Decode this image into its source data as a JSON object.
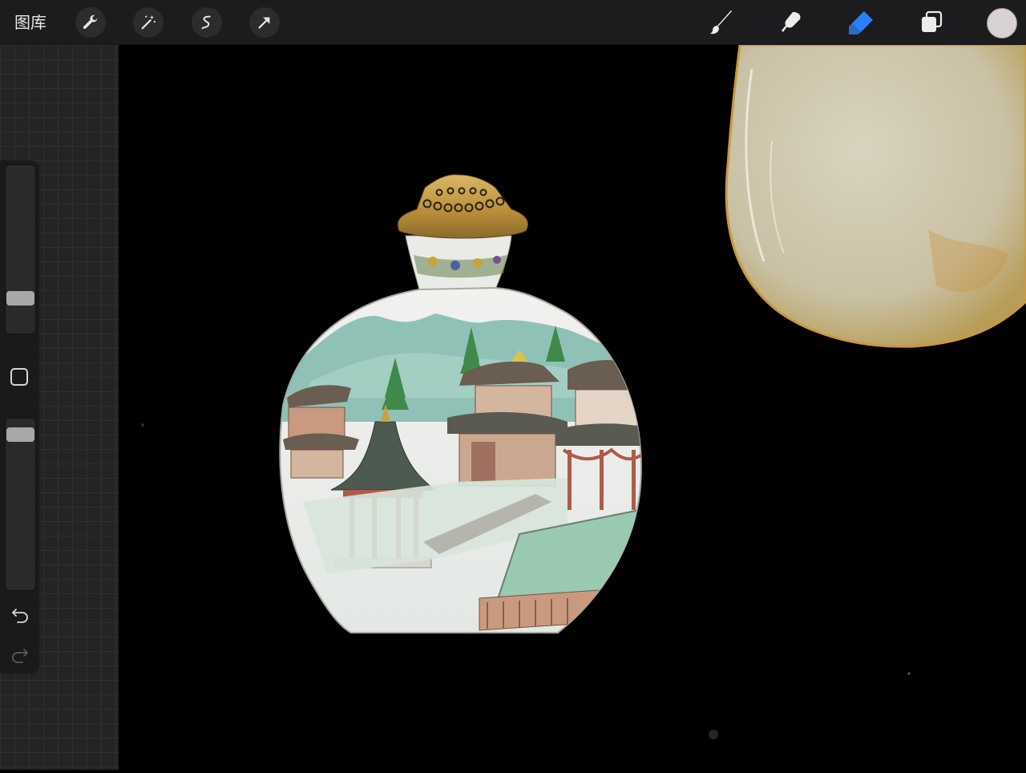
{
  "toolbar": {
    "gallery_label": "图库",
    "left_tools": [
      "wrench-icon",
      "magic-wand-icon",
      "selection-icon",
      "transform-arrow-icon"
    ],
    "right_tools": [
      "brush-icon",
      "smudge-icon",
      "eraser-icon",
      "layers-icon"
    ],
    "active_tool": "eraser",
    "current_color": "#d8d2d2",
    "accent_color": "#2d7ff9"
  },
  "sidebar": {
    "brush_size_level": 0.18,
    "opacity_level": 0.95,
    "controls": [
      "size-slider",
      "modify-button",
      "opacity-slider",
      "undo-icon",
      "redo-icon"
    ]
  }
}
